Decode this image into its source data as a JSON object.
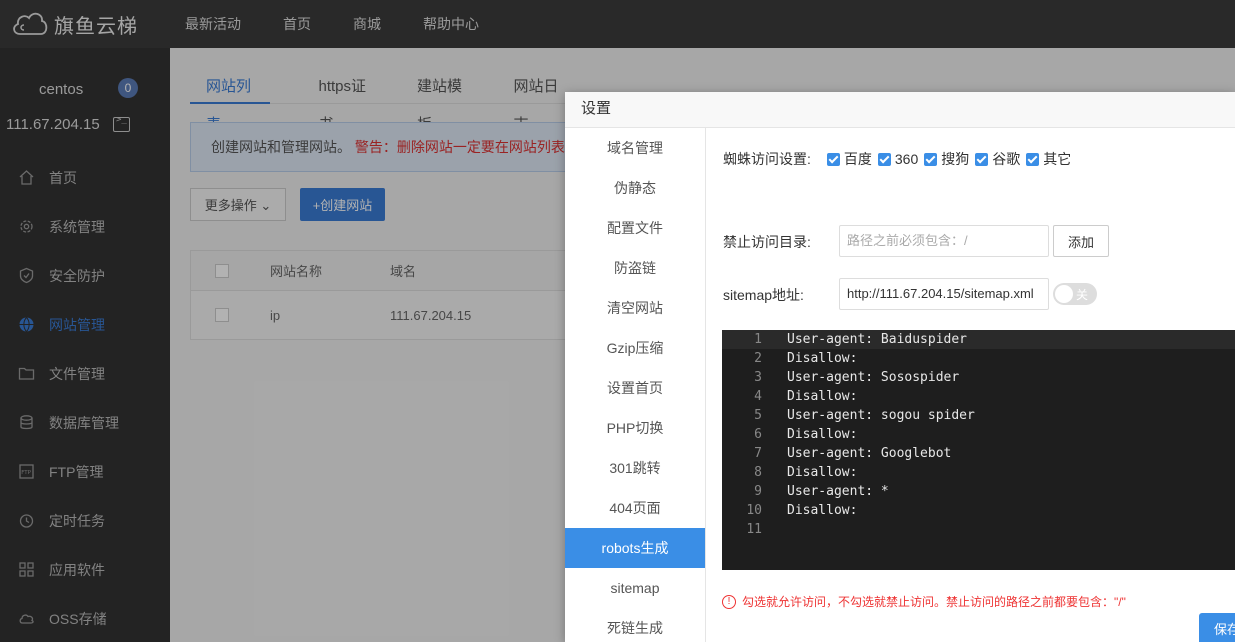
{
  "app": {
    "logo_text": "旗鱼云梯"
  },
  "topnav": [
    "最新活动",
    "首页",
    "商城",
    "帮助中心"
  ],
  "user": {
    "name": "centos",
    "badge": "0",
    "ip": "111.67.204.15"
  },
  "sidebar": {
    "items": [
      {
        "label": "首页",
        "icon": "home-icon"
      },
      {
        "label": "系统管理",
        "icon": "gear-icon"
      },
      {
        "label": "安全防护",
        "icon": "shield-icon"
      },
      {
        "label": "网站管理",
        "icon": "globe-icon",
        "active": true
      },
      {
        "label": "文件管理",
        "icon": "folder-icon"
      },
      {
        "label": "数据库管理",
        "icon": "database-icon"
      },
      {
        "label": "FTP管理",
        "icon": "ftp-icon"
      },
      {
        "label": "定时任务",
        "icon": "clock-icon"
      },
      {
        "label": "应用软件",
        "icon": "apps-icon"
      },
      {
        "label": "OSS存储",
        "icon": "cloud-icon"
      }
    ]
  },
  "main": {
    "tabs": [
      "网站列表",
      "https证书",
      "建站模板",
      "网站日志"
    ],
    "notice_text": "创建网站和管理网站。",
    "notice_warn": "警告：删除网站一定要在网站列表",
    "more_label": "更多操作 ⌄",
    "create_label": "+创建网站",
    "table": {
      "headers": [
        "网站名称",
        "域名"
      ],
      "rows": [
        {
          "name": "ip",
          "domain": "111.67.204.15"
        }
      ]
    }
  },
  "modal": {
    "title": "设置",
    "nav": [
      "域名管理",
      "伪静态",
      "配置文件",
      "防盗链",
      "清空网站",
      "Gzip压缩",
      "设置首页",
      "PHP切换",
      "301跳转",
      "404页面",
      "robots生成",
      "sitemap",
      "死链生成"
    ],
    "active_nav": "robots生成",
    "spider_label": "蜘蛛访问设置:",
    "spiders": [
      "百度",
      "360",
      "搜狗",
      "谷歌",
      "其它"
    ],
    "dir_label": "禁止访问目录:",
    "dir_placeholder": "路径之前必须包含：/",
    "add_label": "添加",
    "sitemap_label": "sitemap地址:",
    "sitemap_value": "http://111.67.204.15/sitemap.xml",
    "toggle_label": "关",
    "code_lines": [
      "User-agent: Baiduspider",
      "Disallow:",
      "User-agent: Sosospider",
      "Disallow:",
      "User-agent: sogou spider",
      "Disallow:",
      "User-agent: Googlebot",
      "Disallow:",
      "User-agent: *",
      "Disallow:",
      ""
    ],
    "tip": "勾选就允许访问，不勾选就禁止访问。禁止访问的路径之前都要包含：\"/\"",
    "save_label": "保存"
  },
  "colors": {
    "accent": "#3a8ee6",
    "warning": "#e33333",
    "sidebar_bg": "#333333",
    "topbar_bg": "#3c3c3c"
  }
}
